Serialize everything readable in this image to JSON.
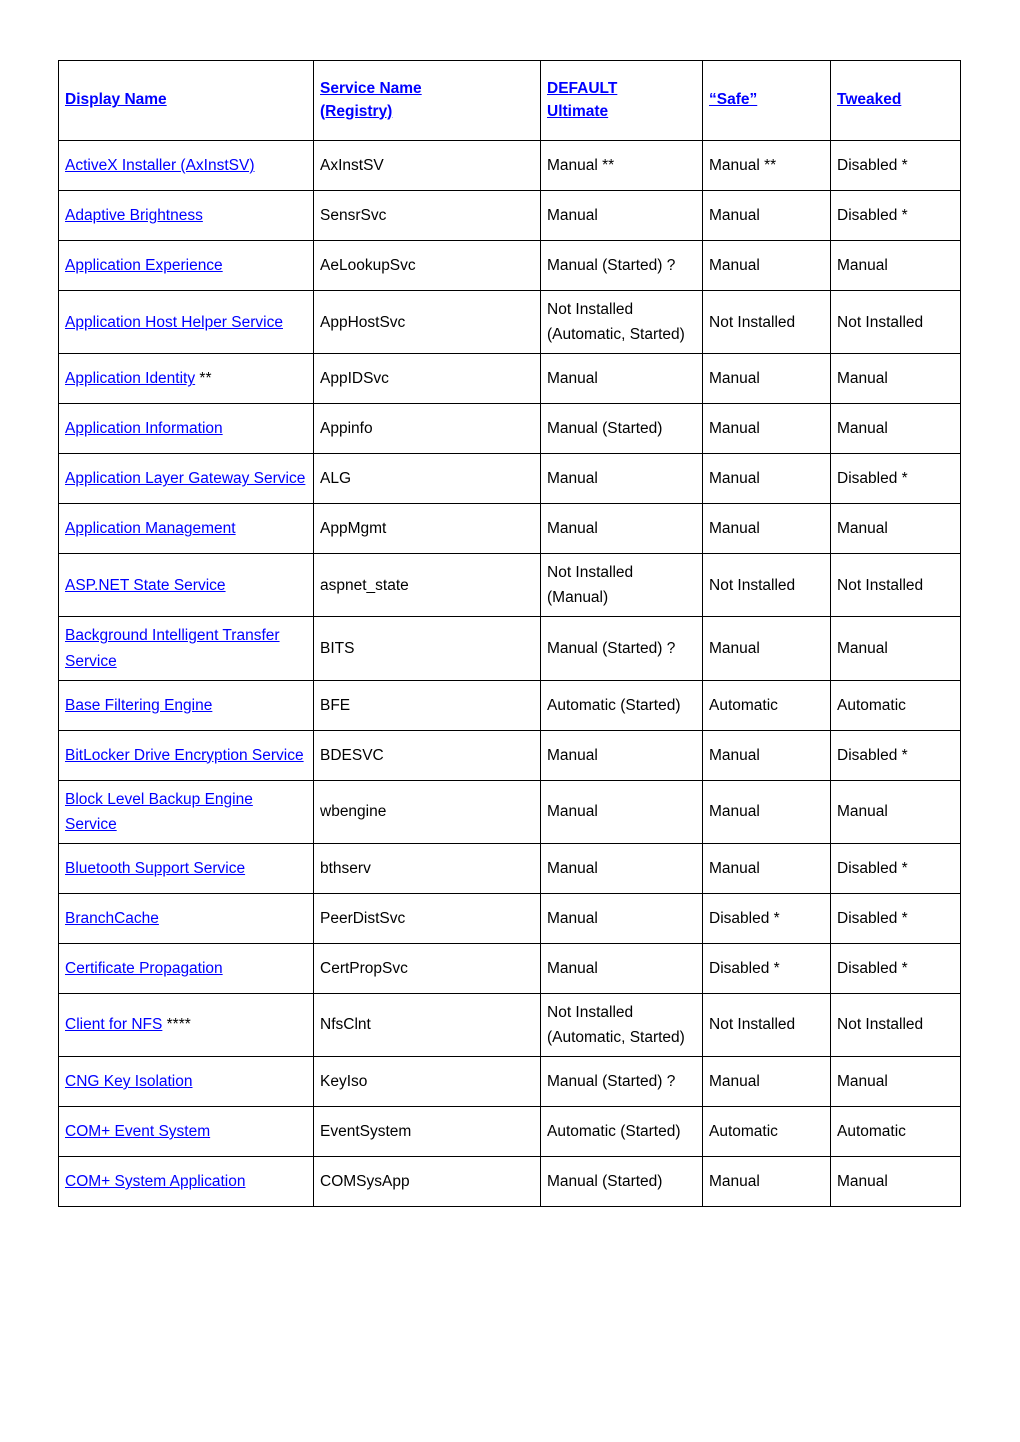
{
  "document": {
    "type": "services-configuration-table",
    "background_color": "#ffffff",
    "link_color": "#0000FF",
    "text_color": "#000000",
    "border_color": "#000000"
  },
  "table": {
    "columns": [
      {
        "key": "display_name",
        "header_lines": [
          "Display Name"
        ]
      },
      {
        "key": "service_name",
        "header_lines": [
          "Service Name",
          "(Registry)"
        ]
      },
      {
        "key": "default_ultimate",
        "header_lines": [
          "DEFAULT",
          "Ultimate"
        ]
      },
      {
        "key": "safe",
        "header_lines": [
          "“Safe”"
        ]
      },
      {
        "key": "tweaked",
        "header_lines": [
          "Tweaked"
        ]
      }
    ],
    "rows": [
      {
        "display_name": "ActiveX Installer (AxInstSV)",
        "display_suffix": "",
        "service_name": "AxInstSV",
        "default_ultimate": "Manual **",
        "safe": "Manual **",
        "tweaked": "Disabled *"
      },
      {
        "display_name": "Adaptive Brightness",
        "display_suffix": "",
        "service_name": "SensrSvc",
        "default_ultimate": "Manual",
        "safe": "Manual",
        "tweaked": "Disabled *"
      },
      {
        "display_name": "Application Experience",
        "display_suffix": "",
        "service_name": "AeLookupSvc",
        "default_ultimate": "Manual (Started) ?",
        "safe": "Manual",
        "tweaked": "Manual"
      },
      {
        "display_name": "Application Host Helper Service",
        "display_suffix": "",
        "service_name": "AppHostSvc",
        "default_ultimate": "Not Installed (Automatic, Started)",
        "safe": "Not Installed",
        "tweaked": "Not Installed"
      },
      {
        "display_name": "Application Identity",
        "display_suffix": " **",
        "service_name": "AppIDSvc",
        "default_ultimate": "Manual",
        "safe": "Manual",
        "tweaked": "Manual"
      },
      {
        "display_name": "Application Information",
        "display_suffix": "",
        "service_name": "Appinfo",
        "default_ultimate": "Manual (Started)",
        "safe": "Manual",
        "tweaked": "Manual"
      },
      {
        "display_name": "Application Layer Gateway Service",
        "display_suffix": "",
        "service_name": "ALG",
        "default_ultimate": "Manual",
        "safe": "Manual",
        "tweaked": "Disabled *"
      },
      {
        "display_name": "Application Management",
        "display_suffix": "",
        "service_name": "AppMgmt",
        "default_ultimate": "Manual",
        "safe": "Manual",
        "tweaked": "Manual"
      },
      {
        "display_name": "ASP.NET State Service",
        "display_suffix": "",
        "service_name": "aspnet_state",
        "default_ultimate": "Not Installed (Manual)",
        "safe": "Not Installed",
        "tweaked": "Not Installed"
      },
      {
        "display_name": "Background Intelligent Transfer Service",
        "display_suffix": "",
        "service_name": "BITS",
        "default_ultimate": "Manual (Started) ?",
        "safe": "Manual",
        "tweaked": "Manual"
      },
      {
        "display_name": "Base Filtering Engine",
        "display_suffix": "",
        "service_name": "BFE",
        "default_ultimate": "Automatic (Started)",
        "safe": "Automatic",
        "tweaked": "Automatic"
      },
      {
        "display_name": "BitLocker Drive Encryption Service",
        "display_suffix": "",
        "service_name": "BDESVC",
        "default_ultimate": "Manual",
        "safe": "Manual",
        "tweaked": "Disabled *"
      },
      {
        "display_name": "Block Level Backup Engine Service",
        "display_suffix": "",
        "service_name": "wbengine",
        "default_ultimate": "Manual",
        "safe": "Manual",
        "tweaked": "Manual"
      },
      {
        "display_name": "Bluetooth Support Service",
        "display_suffix": "",
        "service_name": "bthserv",
        "default_ultimate": "Manual",
        "safe": "Manual",
        "tweaked": "Disabled *"
      },
      {
        "display_name": "BranchCache",
        "display_suffix": "",
        "service_name": "PeerDistSvc",
        "default_ultimate": "Manual",
        "safe": "Disabled *",
        "tweaked": "Disabled *"
      },
      {
        "display_name": "Certificate Propagation",
        "display_suffix": "",
        "service_name": "CertPropSvc",
        "default_ultimate": "Manual",
        "safe": "Disabled *",
        "tweaked": "Disabled *"
      },
      {
        "display_name": "Client for NFS",
        "display_suffix": " ****",
        "service_name": "NfsClnt",
        "default_ultimate": "Not Installed (Automatic, Started)",
        "safe": "Not Installed",
        "tweaked": "Not Installed"
      },
      {
        "display_name": "CNG Key Isolation",
        "display_suffix": "",
        "service_name": "KeyIso",
        "default_ultimate": "Manual (Started) ?",
        "safe": "Manual",
        "tweaked": "Manual"
      },
      {
        "display_name": "COM+ Event System",
        "display_suffix": "",
        "service_name": "EventSystem",
        "default_ultimate": "Automatic (Started)",
        "safe": "Automatic",
        "tweaked": "Automatic"
      },
      {
        "display_name": "COM+ System Application",
        "display_suffix": "",
        "service_name": "COMSysApp",
        "default_ultimate": "Manual (Started)",
        "safe": "Manual",
        "tweaked": "Manual"
      }
    ]
  }
}
